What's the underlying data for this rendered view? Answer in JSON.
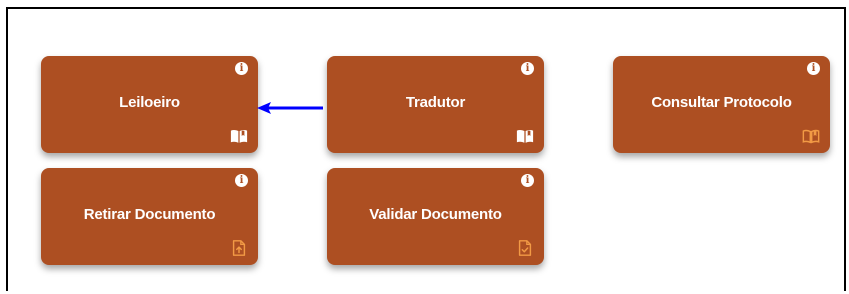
{
  "colors": {
    "card_bg": "#ad4f22",
    "card_text": "#ffffff",
    "icon_white": "#ffffff",
    "icon_orange": "#f29a45",
    "arrow": "#0000ff"
  },
  "cards": {
    "leiloeiro": {
      "label": "Leiloeiro",
      "info": "i",
      "corner_icon": "book-open-icon"
    },
    "tradutor": {
      "label": "Tradutor",
      "info": "i",
      "corner_icon": "book-open-icon"
    },
    "consultar_protocolo": {
      "label": "Consultar Protocolo",
      "info": "i",
      "corner_icon": "book-open-outline-icon"
    },
    "retirar_documento": {
      "label": "Retirar Documento",
      "info": "i",
      "corner_icon": "file-upload-icon"
    },
    "validar_documento": {
      "label": "Validar Documento",
      "info": "i",
      "corner_icon": "file-check-icon"
    }
  },
  "annotation": {
    "icon": "arrow-left-icon"
  }
}
